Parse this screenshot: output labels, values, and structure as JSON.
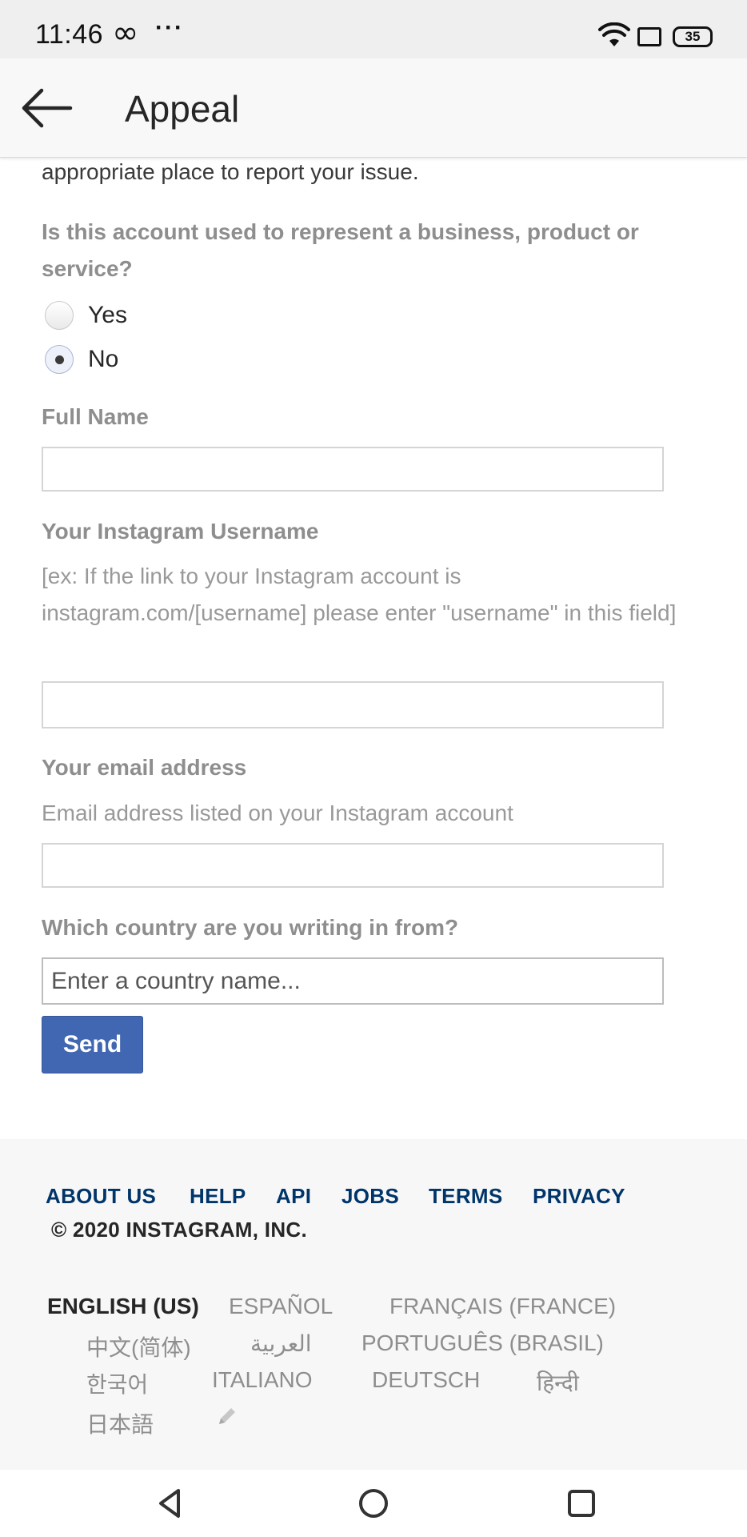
{
  "status_bar": {
    "time": "11:46",
    "infinity_glyph": "∞",
    "dots": "···",
    "battery": "35"
  },
  "app_bar": {
    "back_icon": "arrow-left-icon",
    "title": "Appeal"
  },
  "form": {
    "intro_tail": "appropriate place to report your issue.",
    "business_question": "Is this account used to represent a business, product or service?",
    "business_options": [
      {
        "label": "Yes",
        "checked": false
      },
      {
        "label": "No",
        "checked": true
      }
    ],
    "full_name": {
      "label": "Full Name",
      "value": "",
      "placeholder": ""
    },
    "username": {
      "label": "Your Instagram Username",
      "help": "[ex: If the link to your Instagram account is instagram.com/[username] please enter \"username\" in this field]",
      "value": "",
      "placeholder": ""
    },
    "email": {
      "label": "Your email address",
      "help": "Email address listed on your Instagram account",
      "value": "",
      "placeholder": ""
    },
    "country": {
      "label": "Which country are you writing in from?",
      "value": "",
      "placeholder": "Enter a country name..."
    },
    "send_label": "Send"
  },
  "footer": {
    "links": [
      "ABOUT US",
      "HELP",
      "API",
      "JOBS",
      "TERMS",
      "PRIVACY"
    ],
    "copyright": "© 2020 INSTAGRAM, INC.",
    "languages": [
      "ENGLISH (US)",
      "ESPAÑOL",
      "FRANÇAIS (FRANCE)",
      "中文(简体)",
      "العربية",
      "PORTUGUÊS (BRASIL)",
      "한국어",
      "ITALIANO",
      "DEUTSCH",
      "हिन्दी",
      "日本語"
    ],
    "current_language": "ENGLISH (US)",
    "edit_icon": "pencil-icon"
  },
  "nav_bar": {
    "buttons": [
      "back-triangle-icon",
      "home-circle-icon",
      "recents-square-icon"
    ]
  },
  "colors": {
    "link": "#003569",
    "button": "#4267b2",
    "label_gray": "#8e8e8e"
  }
}
